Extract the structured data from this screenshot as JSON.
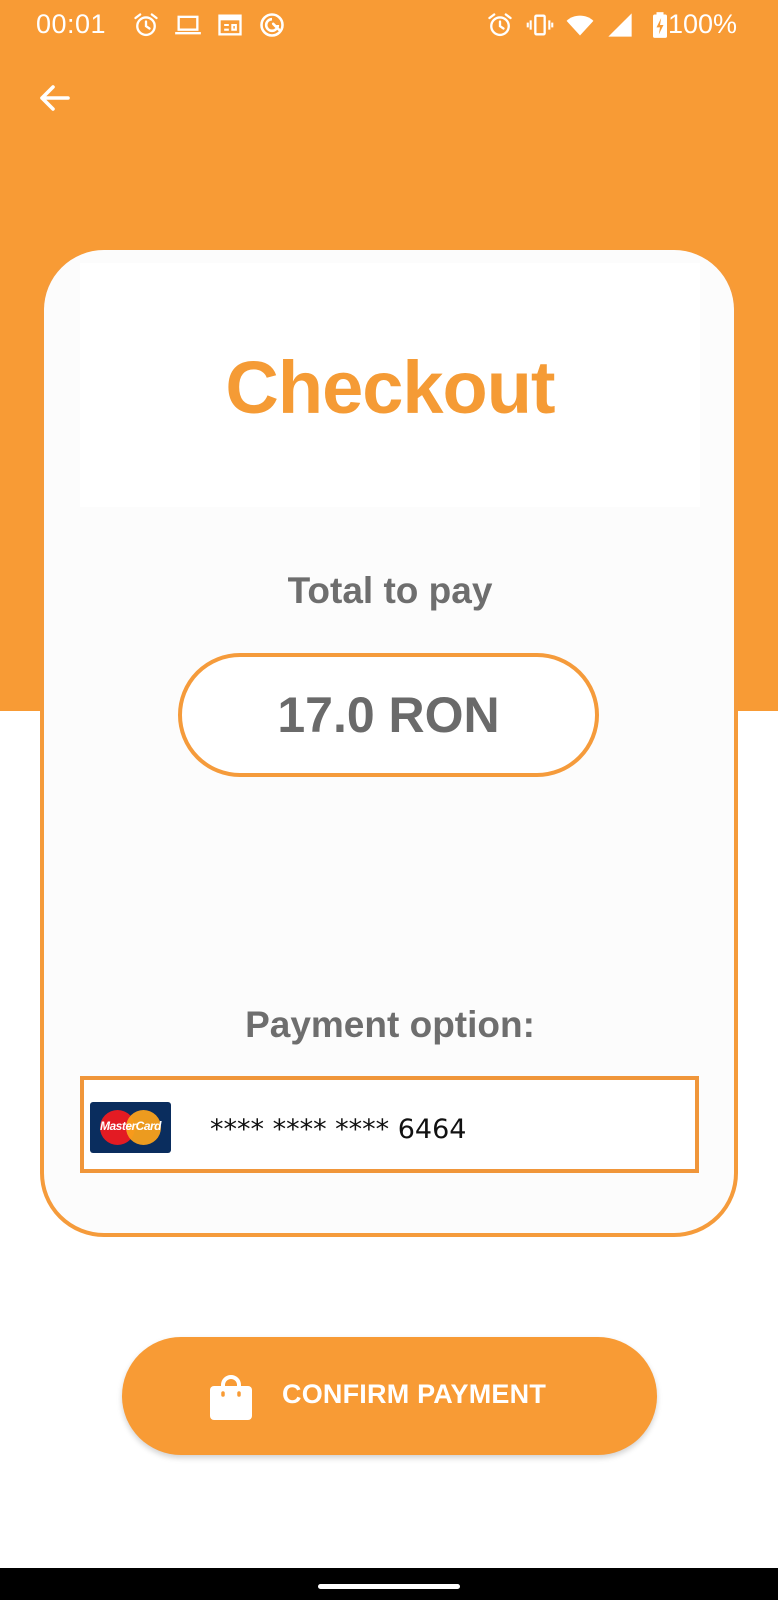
{
  "status_bar": {
    "time": "00:01",
    "battery_text": "100%",
    "left_icons": [
      "alarm-icon",
      "laptop-icon",
      "calendar-icon",
      "app-notification-icon"
    ],
    "right_icons": [
      "alarm-icon",
      "vibrate-icon",
      "wifi-icon",
      "cellular-signal-icon",
      "battery-charging-icon"
    ]
  },
  "header": {
    "back_icon": "arrow-left-icon"
  },
  "checkout": {
    "title": "Checkout",
    "total_label": "Total to pay",
    "total_amount": "17.0 RON",
    "payment_label": "Payment option:",
    "card": {
      "brand": "MasterCard",
      "masked_number": "**** **** **** 6464"
    }
  },
  "actions": {
    "confirm_label": "CONFIRM PAYMENT",
    "confirm_icon": "shopping-bag-icon"
  },
  "colors": {
    "accent": "#f89b35",
    "text_gray": "#6e6e6e",
    "card_border": "#f59b3b"
  }
}
